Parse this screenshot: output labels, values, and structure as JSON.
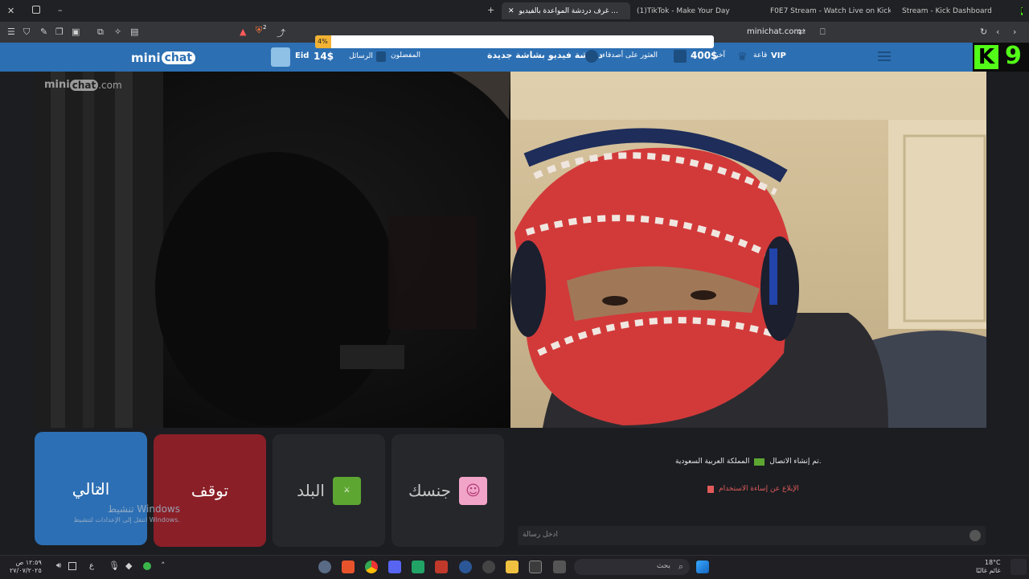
{
  "browser": {
    "tabs": [
      {
        "title": "غرف دردشة المواعدة بالفيديو ...",
        "active": true
      },
      {
        "title": "(1)TikTok - Make Your Day",
        "active": false
      },
      {
        "title": "F0E7 Stream - Watch Live on Kick",
        "active": false
      },
      {
        "title": "Stream - Kick Dashboard",
        "active": false
      }
    ],
    "url": "minichat.com",
    "shield_count": "2",
    "loading_progress_label": "4%"
  },
  "site": {
    "logo_mini": "mini",
    "logo_chat": "chat",
    "user_name": "Eid",
    "messages_label": "الرسائل",
    "balance": "14$",
    "favorites_label": "المفضلون",
    "new_chat_banner": "دردشة فيديو بشاشة جديدة",
    "find_friends_label": "العثور على أصدقاء",
    "other_amount": "400$",
    "other_label": "آخر",
    "vip_label": "VIP",
    "vip_sub": "قاعة"
  },
  "stream_overlay": {
    "number": "9"
  },
  "video": {
    "watermark_mini": "mini",
    "watermark_chat": "chat",
    "watermark_domain": ".com"
  },
  "controls": {
    "next_label": "التالي",
    "stop_label": "توقف",
    "country_label": "البلد",
    "gender_label": "جنسك"
  },
  "windows_watermark": {
    "title": "تنشيط Windows",
    "subtitle": "انتقل إلى الإعدادات لتنشيط Windows."
  },
  "chat": {
    "connected_text": "تم إنشاء الاتصال.",
    "country_text": "المملكة العربية السعودية",
    "report_text": "الإبلاغ عن إساءة الاستخدام",
    "input_placeholder": "ادخل رسالة"
  },
  "taskbar": {
    "search_placeholder": "بحث",
    "time": "١٢:٥٩ ص",
    "date": "٢٧/٠٧/٢٠٢٥",
    "weather_temp": "18°C",
    "weather_desc": "غائم غالبًا",
    "lang": "ع"
  },
  "colors": {
    "site_header": "#2c6fb3",
    "next_button": "#2d6fb4",
    "stop_button": "#8a1f27",
    "neutral_button": "#25272b",
    "kick_green": "#53fc18"
  }
}
